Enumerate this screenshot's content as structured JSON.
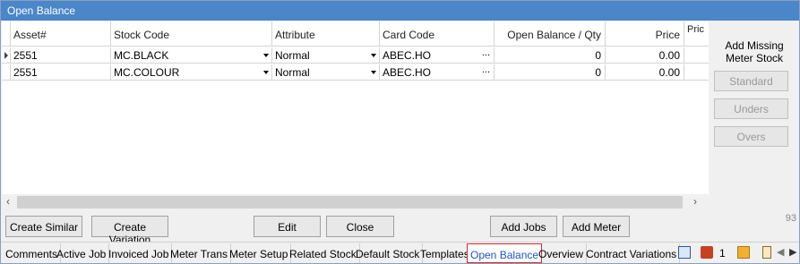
{
  "window": {
    "title": "Open Balance"
  },
  "grid": {
    "columns": [
      "Asset#",
      "Stock Code",
      "Attribute",
      "Card Code",
      "Open Balance / Qty",
      "Price",
      "Pric"
    ],
    "rows": [
      {
        "asset": "2551",
        "stock_code": "MC.BLACK",
        "attribute": "Normal",
        "card_code": "ABEC.HO",
        "open_balance": "0",
        "price": "0.00"
      },
      {
        "asset": "2551",
        "stock_code": "MC.COLOUR",
        "attribute": "Normal",
        "card_code": "ABEC.HO",
        "open_balance": "0",
        "price": "0.00"
      }
    ]
  },
  "side_panel": {
    "heading_line1": "Add Missing",
    "heading_line2": "Meter Stock",
    "buttons": [
      "Standard",
      "Unders",
      "Overs"
    ]
  },
  "actions": {
    "create_similar": "Create Similar",
    "create_variation": "Create Variation",
    "edit": "Edit",
    "close": "Close",
    "add_jobs": "Add Jobs",
    "add_meter": "Add Meter",
    "corner_number": "93"
  },
  "tabs": {
    "items": [
      "Comments",
      "Active Job",
      "Invoiced Job",
      "Meter Trans",
      "Meter Setup",
      "Related Stock",
      "Default Stock",
      "Templates",
      "Open Balance",
      "Overview",
      "Contract Variations"
    ],
    "active": "Open Balance",
    "badge_count": "1"
  },
  "colors": {
    "titlebar": "#4a86c8",
    "active_tab_border": "#d03030",
    "active_tab_text": "#1a56c4"
  }
}
